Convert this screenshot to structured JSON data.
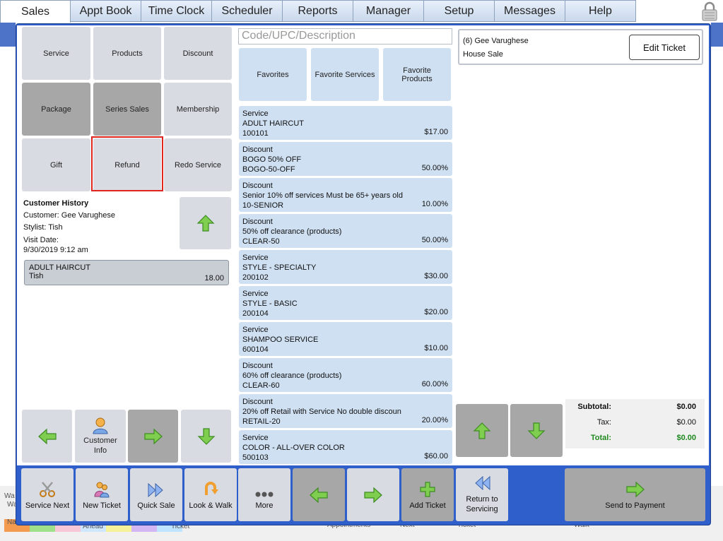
{
  "nav": {
    "tabs": [
      {
        "label": "Sales"
      },
      {
        "label": "Appt Book"
      },
      {
        "label": "Time Clock"
      },
      {
        "label": "Scheduler"
      },
      {
        "label": "Reports"
      },
      {
        "label": "Manager"
      },
      {
        "label": "Setup"
      },
      {
        "label": "Messages"
      },
      {
        "label": "Help"
      }
    ],
    "active": "Sales"
  },
  "categories": {
    "service": "Service",
    "products": "Products",
    "discount": "Discount",
    "package": "Package",
    "series_sales": "Series Sales",
    "membership": "Membership",
    "gift": "Gift",
    "refund": "Refund",
    "redo_service": "Redo Service"
  },
  "history": {
    "title": "Customer History",
    "customer": "Customer: Gee Varughese",
    "stylist": "Stylist: Tish",
    "visit_label": "Visit Date:",
    "visit_date": "9/30/2019 9:12 am",
    "item": {
      "name": "ADULT HAIRCUT",
      "stylist": "Tish",
      "price": "18.00"
    }
  },
  "left_bottom": {
    "customer_info": "Customer Info"
  },
  "search": {
    "placeholder": "Code/UPC/Description"
  },
  "favorites": {
    "favorites": "Favorites",
    "favorite_services": "Favorite Services",
    "favorite_products": "Favorite Products"
  },
  "items": [
    {
      "type": "Service",
      "name": "ADULT HAIRCUT",
      "code": "100101",
      "price": "$17.00"
    },
    {
      "type": "Discount",
      "name": "BOGO 50% OFF",
      "code": "BOGO-50-OFF",
      "price": "50.00%"
    },
    {
      "type": "Discount",
      "name": "Senior 10% off services Must be 65+ years old",
      "code": "10-SENIOR",
      "price": "10.00%"
    },
    {
      "type": "Discount",
      "name": "50% off clearance (products)",
      "code": "CLEAR-50",
      "price": "50.00%"
    },
    {
      "type": "Service",
      "name": "STYLE - SPECIALTY",
      "code": "200102",
      "price": "$30.00"
    },
    {
      "type": "Service",
      "name": "STYLE - BASIC",
      "code": "200104",
      "price": "$20.00"
    },
    {
      "type": "Service",
      "name": "SHAMPOO SERVICE",
      "code": "600104",
      "price": "$10.00"
    },
    {
      "type": "Discount",
      "name": "60% off clearance (products)",
      "code": "CLEAR-60",
      "price": "60.00%"
    },
    {
      "type": "Discount",
      "name": "20% off Retail with Service No double discoun",
      "code": "RETAIL-20",
      "price": "20.00%"
    },
    {
      "type": "Service",
      "name": "COLOR - ALL-OVER COLOR",
      "code": "500103",
      "price": "$60.00"
    }
  ],
  "ticket": {
    "number_name": "(6) Gee Varughese",
    "type": "House Sale",
    "edit_label": "Edit Ticket"
  },
  "totals": {
    "subtotal_label": "Subtotal:",
    "subtotal": "$0.00",
    "tax_label": "Tax:",
    "tax": "$0.00",
    "total_label": "Total:",
    "total": "$0.00"
  },
  "bottom": {
    "service_next": "Service Next",
    "new_ticket": "New Ticket",
    "quick_sale": "Quick Sale",
    "look_walk": "Look & Walk",
    "more": "More",
    "add_ticket": "Add Ticket",
    "return_servicing": "Return to Servicing",
    "send_payment": "Send to Payment"
  },
  "background": {
    "t1": "Wa",
    "t2": "Wa",
    "t3": "Na",
    "t4": "Ahead",
    "t5": "Ticket",
    "t6": "Appointments",
    "t7": "Next",
    "t8": "Ticket",
    "t9": "Walk"
  },
  "colors": {
    "frame_blue": "#2f5fcb",
    "item_blue": "#cfe0f2",
    "highlight_red": "#e0251d",
    "arrow_green": "#5fb43a",
    "total_green": "#1f8a1f"
  }
}
